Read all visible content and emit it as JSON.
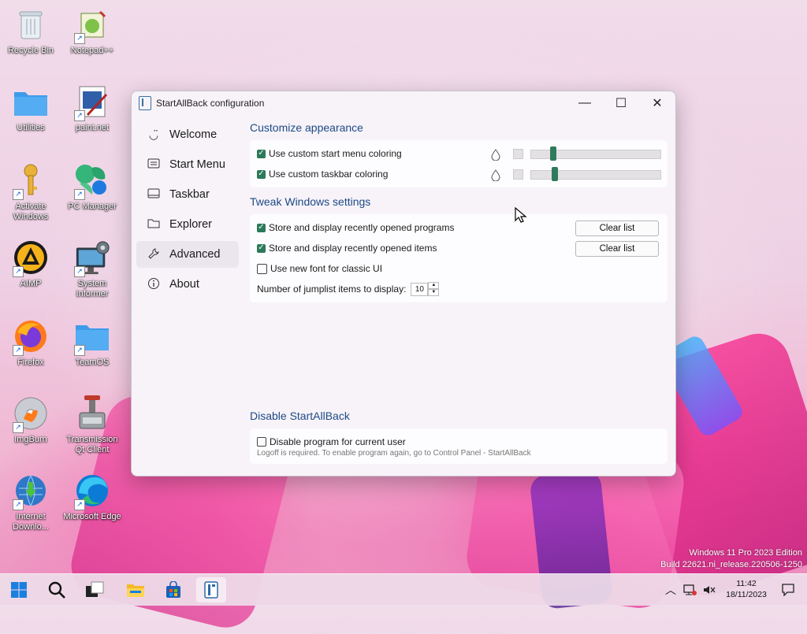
{
  "desktop": {
    "icons": [
      {
        "label": "Recycle Bin",
        "icon": "recycle-bin-icon"
      },
      {
        "label": "Notepad++",
        "icon": "notepad-plus-icon"
      },
      {
        "label": "Utilities",
        "icon": "folder-icon"
      },
      {
        "label": "paint.net",
        "icon": "paintnet-icon"
      },
      {
        "label": "Activate Windows",
        "icon": "key-icon"
      },
      {
        "label": "PC Manager",
        "icon": "pc-manager-icon"
      },
      {
        "label": "AIMP",
        "icon": "aimp-icon"
      },
      {
        "label": "System Informer",
        "icon": "system-informer-icon"
      },
      {
        "label": "Firefox",
        "icon": "firefox-icon"
      },
      {
        "label": "TeamOS",
        "icon": "folder-icon"
      },
      {
        "label": "ImgBurn",
        "icon": "imgburn-icon"
      },
      {
        "label": "Transmission Qt Client",
        "icon": "transmission-icon"
      },
      {
        "label": "Internet Downlo...",
        "icon": "internet-download-icon"
      },
      {
        "label": "Microsoft Edge",
        "icon": "edge-icon"
      }
    ],
    "watermark": {
      "line1": "Windows 11 Pro 2023 Edition",
      "line2": "Build 22621.ni_release.220506-1250"
    }
  },
  "window": {
    "title": "StartAllBack configuration",
    "controls": {
      "minimize": "—",
      "maximize": "☐",
      "close": "✕"
    },
    "sidebar": {
      "items": [
        {
          "label": "Welcome",
          "icon": "smile-icon"
        },
        {
          "label": "Start Menu",
          "icon": "start-menu-icon"
        },
        {
          "label": "Taskbar",
          "icon": "taskbar-icon"
        },
        {
          "label": "Explorer",
          "icon": "folder-icon"
        },
        {
          "label": "Advanced",
          "icon": "wrench-icon"
        },
        {
          "label": "About",
          "icon": "info-icon"
        }
      ],
      "active": "Advanced"
    },
    "appearance": {
      "heading": "Customize appearance",
      "start_menu_coloring": {
        "label": "Use custom start menu coloring",
        "checked": true,
        "slider": 0.17
      },
      "taskbar_coloring": {
        "label": "Use custom taskbar coloring",
        "checked": true,
        "slider": 0.18
      }
    },
    "tweak": {
      "heading": "Tweak Windows settings",
      "recent_programs": {
        "label": "Store and display recently opened programs",
        "checked": true,
        "button": "Clear list"
      },
      "recent_items": {
        "label": "Store and display recently opened items",
        "checked": true,
        "button": "Clear list"
      },
      "classic_font": {
        "label": "Use new font for classic UI",
        "checked": false
      },
      "jumplist": {
        "label": "Number of jumplist items to display:",
        "value": "10"
      }
    },
    "disable": {
      "heading": "Disable StartAllBack",
      "current_user": {
        "label": "Disable program for current user",
        "checked": false
      },
      "note": "Logoff is required. To enable program again, go to Control Panel - StartAllBack"
    }
  },
  "taskbar": {
    "clock": {
      "time": "11:42",
      "date": "18/11/2023"
    }
  },
  "colors": {
    "accent": "#2b7a5a",
    "heading": "#1d4a86"
  }
}
